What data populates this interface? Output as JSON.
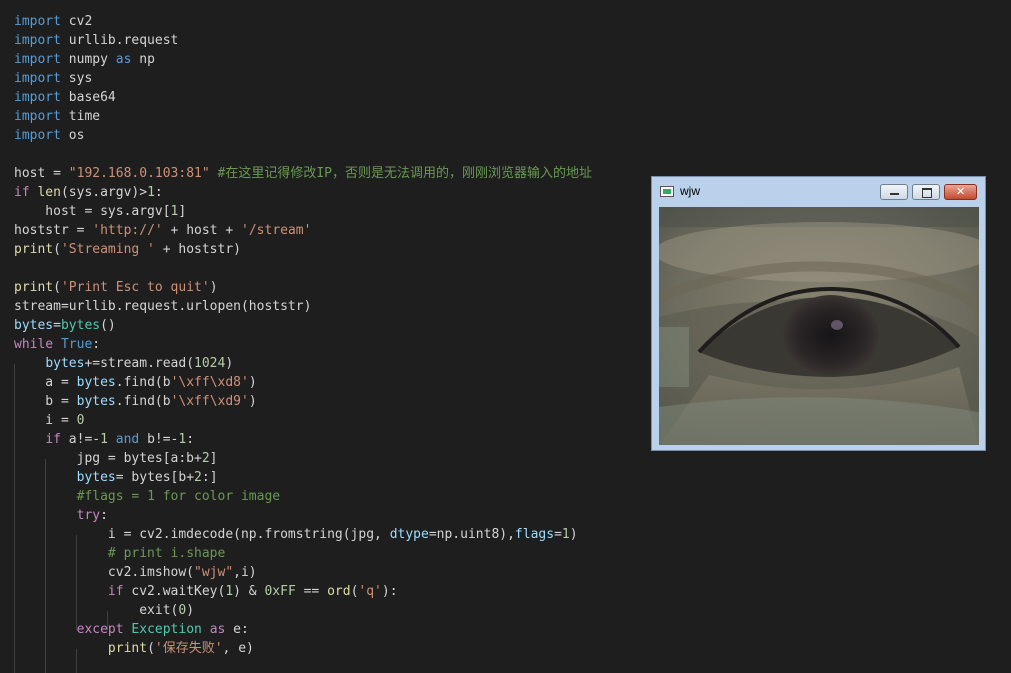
{
  "code_lines": [
    [
      [
        "kw",
        "import"
      ],
      [
        "p",
        " cv2"
      ]
    ],
    [
      [
        "kw",
        "import"
      ],
      [
        "p",
        " urllib.request"
      ]
    ],
    [
      [
        "kw",
        "import"
      ],
      [
        "p",
        " numpy "
      ],
      [
        "kw",
        "as"
      ],
      [
        "p",
        " np"
      ]
    ],
    [
      [
        "kw",
        "import"
      ],
      [
        "p",
        " sys"
      ]
    ],
    [
      [
        "kw",
        "import"
      ],
      [
        "p",
        " base64"
      ]
    ],
    [
      [
        "kw",
        "import"
      ],
      [
        "p",
        " time"
      ]
    ],
    [
      [
        "kw",
        "import"
      ],
      [
        "p",
        " os"
      ]
    ],
    [],
    [
      [
        "p",
        "host = "
      ],
      [
        "str",
        "\"192.168.0.103:81\""
      ],
      [
        "p",
        " "
      ],
      [
        "cm",
        "#在这里记得修改IP，否则是无法调用的，刚刚浏览器输入的地址"
      ]
    ],
    [
      [
        "ctl",
        "if"
      ],
      [
        "p",
        " "
      ],
      [
        "fn",
        "len"
      ],
      [
        "p",
        "(sys.argv)>"
      ],
      [
        "num",
        "1"
      ],
      [
        "p",
        ":"
      ]
    ],
    [
      [
        "p",
        "    host = sys.argv["
      ],
      [
        "num",
        "1"
      ],
      [
        "p",
        "]"
      ]
    ],
    [
      [
        "p",
        "hoststr = "
      ],
      [
        "str",
        "'http://'"
      ],
      [
        "p",
        " + host + "
      ],
      [
        "str",
        "'/stream'"
      ]
    ],
    [
      [
        "fn",
        "print"
      ],
      [
        "p",
        "("
      ],
      [
        "str",
        "'Streaming '"
      ],
      [
        "p",
        " + hoststr)"
      ]
    ],
    [],
    [
      [
        "fn",
        "print"
      ],
      [
        "p",
        "("
      ],
      [
        "str",
        "'Print Esc to quit'"
      ],
      [
        "p",
        ")"
      ]
    ],
    [
      [
        "p",
        "stream=urllib.request.urlopen(hoststr)"
      ]
    ],
    [
      [
        "var",
        "bytes"
      ],
      [
        "p",
        "="
      ],
      [
        "cls",
        "bytes"
      ],
      [
        "p",
        "()"
      ]
    ],
    [
      [
        "ctl",
        "while"
      ],
      [
        "p",
        " "
      ],
      [
        "kw",
        "True"
      ],
      [
        "p",
        ":"
      ]
    ],
    [
      [
        "p",
        "    "
      ],
      [
        "var",
        "bytes"
      ],
      [
        "p",
        "+=stream.read("
      ],
      [
        "num",
        "1024"
      ],
      [
        "p",
        ")"
      ]
    ],
    [
      [
        "p",
        "    a = "
      ],
      [
        "var",
        "bytes"
      ],
      [
        "p",
        ".find(b"
      ],
      [
        "str",
        "'\\xff\\xd8'"
      ],
      [
        "p",
        ")"
      ]
    ],
    [
      [
        "p",
        "    b = "
      ],
      [
        "var",
        "bytes"
      ],
      [
        "p",
        ".find(b"
      ],
      [
        "str",
        "'\\xff\\xd9'"
      ],
      [
        "p",
        ")"
      ]
    ],
    [
      [
        "p",
        "    i = "
      ],
      [
        "num",
        "0"
      ]
    ],
    [
      [
        "p",
        "    "
      ],
      [
        "ctl",
        "if"
      ],
      [
        "p",
        " a!=-"
      ],
      [
        "num",
        "1"
      ],
      [
        "p",
        " "
      ],
      [
        "kw",
        "and"
      ],
      [
        "p",
        " b!=-"
      ],
      [
        "num",
        "1"
      ],
      [
        "p",
        ":"
      ]
    ],
    [
      [
        "p",
        "        jpg = bytes[a:b+"
      ],
      [
        "num",
        "2"
      ],
      [
        "p",
        "]"
      ]
    ],
    [
      [
        "p",
        "        "
      ],
      [
        "var",
        "bytes"
      ],
      [
        "p",
        "= bytes[b+"
      ],
      [
        "num",
        "2"
      ],
      [
        "p",
        ":]"
      ]
    ],
    [
      [
        "p",
        "        "
      ],
      [
        "cm",
        "#flags = 1 for color image"
      ]
    ],
    [
      [
        "p",
        "        "
      ],
      [
        "ctl",
        "try"
      ],
      [
        "p",
        ":"
      ]
    ],
    [
      [
        "p",
        "            i = cv2.imdecode(np.fromstring(jpg, "
      ],
      [
        "var",
        "dtype"
      ],
      [
        "p",
        "=np.uint8),"
      ],
      [
        "var",
        "flags"
      ],
      [
        "p",
        "="
      ],
      [
        "num",
        "1"
      ],
      [
        "p",
        ")"
      ]
    ],
    [
      [
        "p",
        "            "
      ],
      [
        "cm",
        "# print i.shape"
      ]
    ],
    [
      [
        "p",
        "            cv2.imshow("
      ],
      [
        "str",
        "\"wjw\""
      ],
      [
        "p",
        ",i)"
      ]
    ],
    [
      [
        "p",
        "            "
      ],
      [
        "ctl",
        "if"
      ],
      [
        "p",
        " cv2.waitKey("
      ],
      [
        "num",
        "1"
      ],
      [
        "p",
        ") & "
      ],
      [
        "num",
        "0xFF"
      ],
      [
        "p",
        " == "
      ],
      [
        "fn",
        "ord"
      ],
      [
        "p",
        "("
      ],
      [
        "str",
        "'q'"
      ],
      [
        "p",
        "):"
      ]
    ],
    [
      [
        "p",
        "                exit("
      ],
      [
        "num",
        "0"
      ],
      [
        "p",
        ")"
      ]
    ],
    [
      [
        "p",
        "        "
      ],
      [
        "ctl",
        "except"
      ],
      [
        "p",
        " "
      ],
      [
        "cls",
        "Exception"
      ],
      [
        "p",
        " "
      ],
      [
        "ctl",
        "as"
      ],
      [
        "p",
        " e:"
      ]
    ],
    [
      [
        "p",
        "            "
      ],
      [
        "fn",
        "print"
      ],
      [
        "p",
        "("
      ],
      [
        "str",
        "'保存失败'"
      ],
      [
        "p",
        ", e)"
      ]
    ]
  ],
  "window": {
    "title": "wjw",
    "minimize_icon": "minimize-icon",
    "maximize_icon": "maximize-icon",
    "close_icon": "close-icon",
    "app_icon": "app-window-icon"
  },
  "colors": {
    "background": "#1e1e1e",
    "keyword": "#569cd6",
    "control": "#c586c0",
    "function": "#dcdcaa",
    "string": "#ce9178",
    "number": "#b5cea8",
    "comment": "#6a9955",
    "variable": "#9cdcfe",
    "class": "#4ec9b0",
    "text": "#d4d4d4"
  }
}
